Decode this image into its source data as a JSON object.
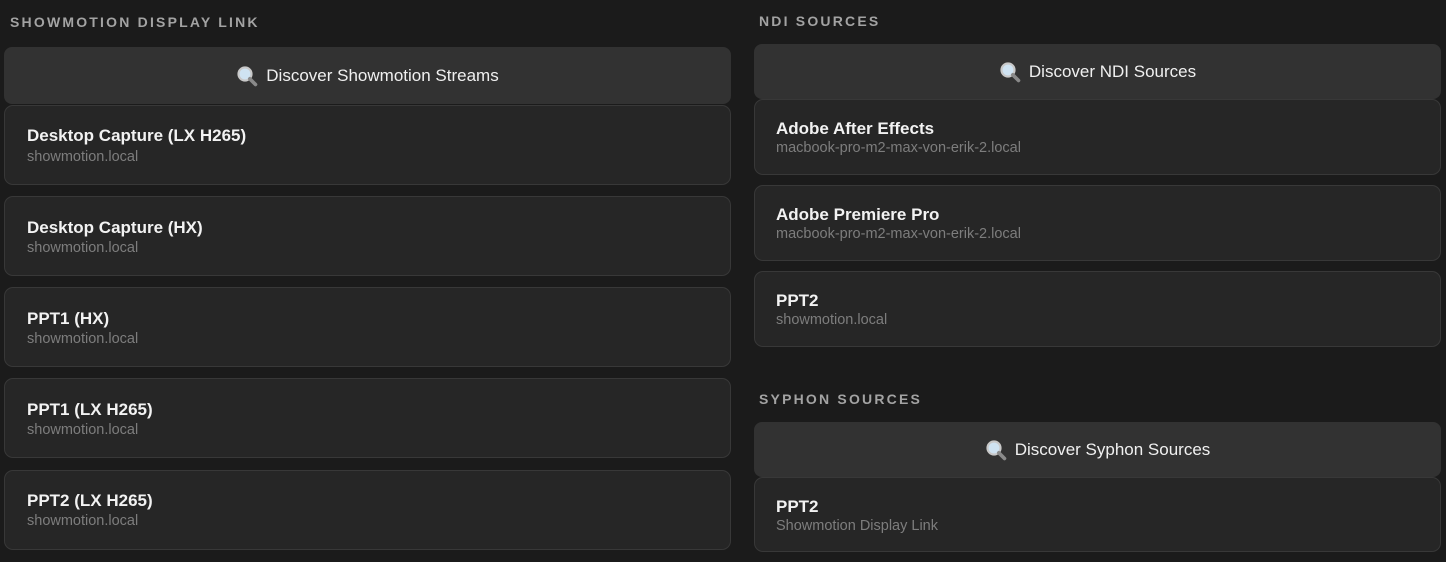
{
  "showmotion": {
    "title": "SHOWMOTION DISPLAY LINK",
    "discover_label": "Discover Showmotion Streams",
    "items": [
      {
        "name": "Desktop Capture (LX H265)",
        "host": "showmotion.local"
      },
      {
        "name": "Desktop Capture (HX)",
        "host": "showmotion.local"
      },
      {
        "name": "PPT1 (HX)",
        "host": "showmotion.local"
      },
      {
        "name": "PPT1 (LX H265)",
        "host": "showmotion.local"
      },
      {
        "name": "PPT2 (LX H265)",
        "host": "showmotion.local"
      }
    ]
  },
  "ndi": {
    "title": "NDI SOURCES",
    "discover_label": "Discover NDI Sources",
    "items": [
      {
        "name": "Adobe After Effects",
        "host": "macbook-pro-m2-max-von-erik-2.local"
      },
      {
        "name": "Adobe Premiere Pro",
        "host": "macbook-pro-m2-max-von-erik-2.local"
      },
      {
        "name": "PPT2",
        "host": "showmotion.local"
      }
    ]
  },
  "syphon": {
    "title": "SYPHON SOURCES",
    "discover_label": "Discover Syphon Sources",
    "items": [
      {
        "name": "PPT2",
        "host": "Showmotion Display Link"
      }
    ]
  },
  "icons": {
    "discover": "magnifying-glass-icon"
  }
}
